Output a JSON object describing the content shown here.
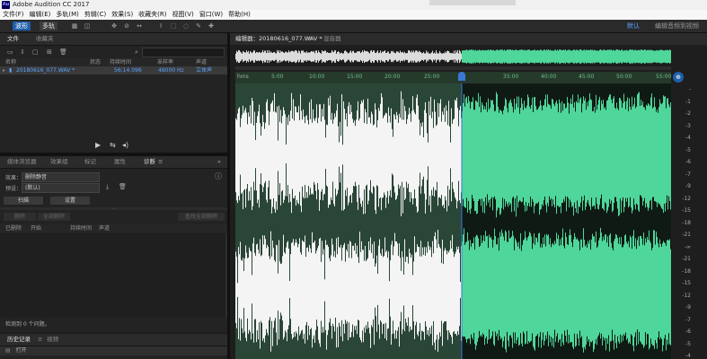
{
  "window": {
    "title": "Adobe Audition CC 2017",
    "app_icon": "Au"
  },
  "menu": [
    "文件(F)",
    "编辑(E)",
    "多轨(M)",
    "剪辑(C)",
    "效果(S)",
    "收藏夹(R)",
    "视图(V)",
    "窗口(W)",
    "帮助(H)"
  ],
  "toolbar": {
    "mode_waveform": "波形",
    "mode_multitrack": "多轨",
    "workspace_default": "默认",
    "workspace_edit": "编辑音频到视频"
  },
  "files_panel": {
    "tabs": [
      "文件",
      "收藏夹"
    ],
    "columns": [
      "名称",
      "状态",
      "持续时间",
      "采样率",
      "声道"
    ],
    "file": {
      "name": "20180616_077.WAV *",
      "duration": "56:14.096",
      "sample_rate": "48000 Hz",
      "channels": "立体声"
    }
  },
  "diag_panel": {
    "tabs": [
      "媒体浏览器",
      "效果组",
      "标记",
      "属性",
      "诊断"
    ],
    "effect_label": "效果：",
    "effect_value": "删除静音",
    "preset_label": "预设：",
    "preset_value": "(默认)",
    "scan_button": "扫描",
    "settings_button": "设置",
    "delete_button": "删除",
    "delete_all_button": "全部删除",
    "find_delete_button": "查找全部删除",
    "columns": [
      "已删除",
      "开始",
      "持续时间",
      "声道"
    ],
    "status": "检测到 0 个问题。"
  },
  "history_panel": {
    "tabs": [
      "历史记录",
      "视频"
    ],
    "item": "打开"
  },
  "editor": {
    "tab_label": "编辑器：20180616_077.WAV *",
    "mixer_label": "混音器",
    "ruler_unit": "hms",
    "ruler_ticks": [
      "5:00",
      "10:00",
      "15:00",
      "20:00",
      "25:00",
      "35:00",
      "40:00",
      "45:00",
      "50:00",
      "55:00"
    ],
    "db_unit": "dB",
    "db_ticks": [
      "-",
      "-1",
      "-2",
      "-3",
      "-4",
      "-5",
      "-6",
      "-7",
      "-9",
      "-12",
      "-15",
      "-18",
      "-21",
      "-∞",
      "-21",
      "-18",
      "-15",
      "-12",
      "-9",
      "-7",
      "-6",
      "-5",
      "-4"
    ],
    "playhead_fraction": 0.52,
    "colors": {
      "waveform_unselected": "#f4f4f4",
      "waveform_selected": "#4fd69a",
      "background_unselected": "#2a4637",
      "background_selected": "#101a14",
      "accent": "#1f5faa"
    }
  }
}
